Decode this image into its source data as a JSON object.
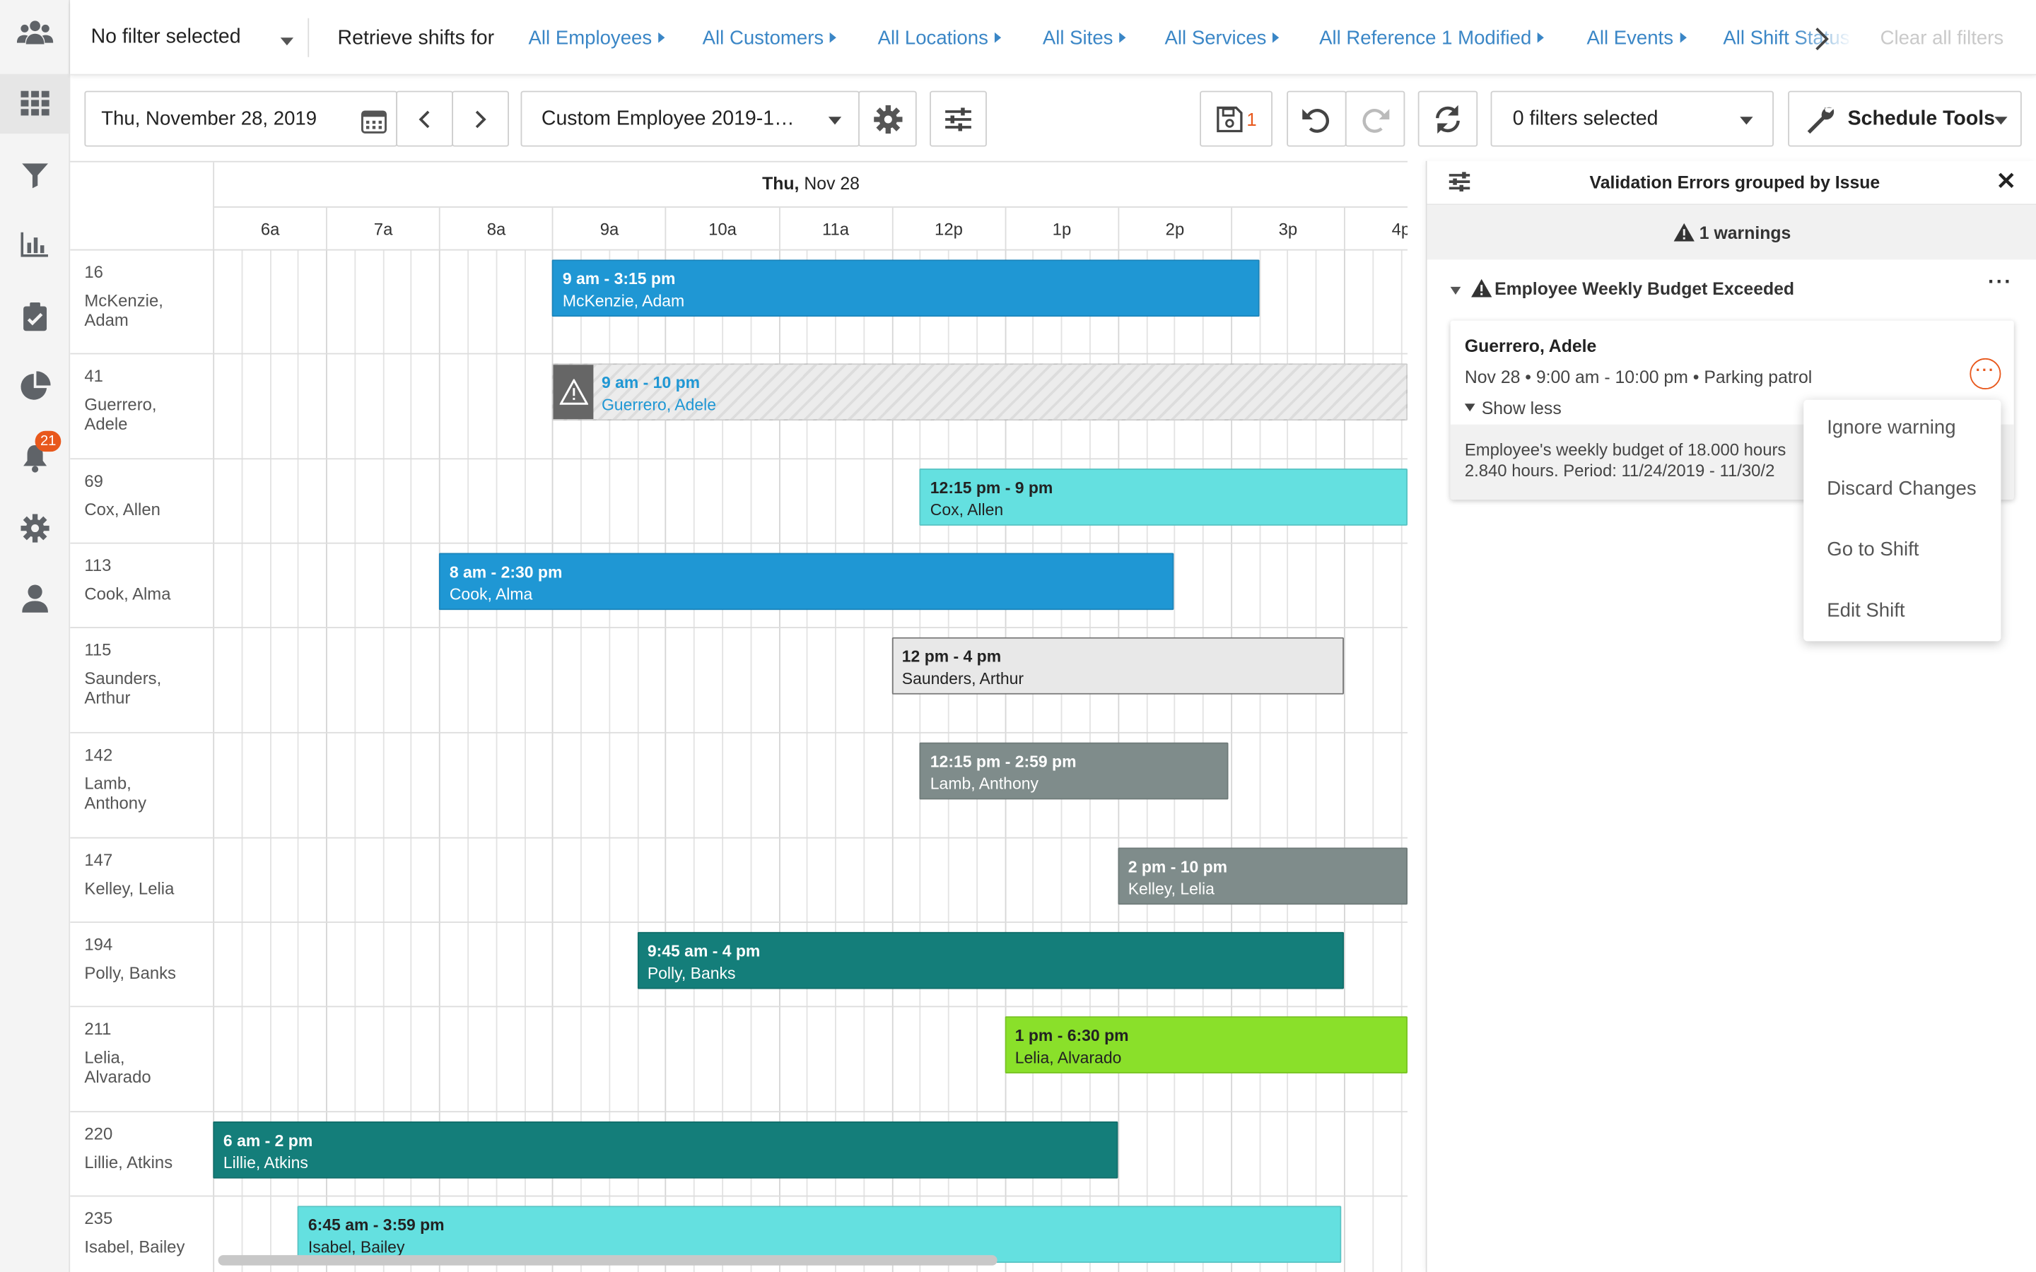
{
  "sidebar": {
    "notification_count": "21"
  },
  "filterbar": {
    "filter_select": "No filter selected",
    "retrieve_label": "Retrieve shifts for",
    "links": [
      "All Employees",
      "All Customers",
      "All Locations",
      "All Sites",
      "All Services",
      "All Reference 1 Modified",
      "All Events",
      "All Shift Status"
    ],
    "clear_all": "Clear all filters"
  },
  "toolbar": {
    "date": "Thu, November 28, 2019",
    "view": "Custom Employee 2019-1…",
    "save_count": "1",
    "filters": "0 filters selected",
    "schedule_tools": "Schedule Tools"
  },
  "schedule": {
    "day_prefix": "Thu,",
    "day": "Nov 28",
    "hours": [
      "6a",
      "7a",
      "8a",
      "9a",
      "10a",
      "11a",
      "12p",
      "1p",
      "2p",
      "3p",
      "4p"
    ],
    "rows": [
      {
        "id": "16",
        "name": "McKenzie, Adam",
        "name_lines": [
          "McKenzie,",
          "Adam"
        ]
      },
      {
        "id": "41",
        "name": "Guerrero, Adele",
        "name_lines": [
          "Guerrero,",
          "Adele"
        ]
      },
      {
        "id": "69",
        "name": "Cox, Allen",
        "name_lines": [
          "Cox, Allen"
        ]
      },
      {
        "id": "113",
        "name": "Cook, Alma",
        "name_lines": [
          "Cook, Alma"
        ]
      },
      {
        "id": "115",
        "name": "Saunders, Arthur",
        "name_lines": [
          "Saunders,",
          "Arthur"
        ]
      },
      {
        "id": "142",
        "name": "Lamb, Anthony",
        "name_lines": [
          "Lamb,",
          "Anthony"
        ]
      },
      {
        "id": "147",
        "name": "Kelley, Lelia",
        "name_lines": [
          "Kelley, Lelia"
        ]
      },
      {
        "id": "194",
        "name": "Polly, Banks",
        "name_lines": [
          "Polly, Banks"
        ]
      },
      {
        "id": "211",
        "name": "Lelia, Alvarado",
        "name_lines": [
          "Lelia,",
          "Alvarado"
        ]
      },
      {
        "id": "220",
        "name": "Lillie, Atkins",
        "name_lines": [
          "Lillie, Atkins"
        ]
      },
      {
        "id": "235",
        "name": "Isabel, Bailey",
        "name_lines": [
          "Isabel, Bailey"
        ]
      }
    ],
    "shifts": [
      {
        "row": 0,
        "time": "9 am - 3:15 pm",
        "name": "McKenzie, Adam",
        "start": 9,
        "end": 15.25,
        "color": "#1f97d4",
        "text": "#ffffff"
      },
      {
        "row": 1,
        "time": "9 am - 10 pm",
        "name": "Guerrero, Adele",
        "start": 9,
        "end": 22,
        "color": "hatched",
        "text": "#1f97d4",
        "warning": true
      },
      {
        "row": 2,
        "time": "12:15 pm - 9 pm",
        "name": "Cox, Allen",
        "start": 12.25,
        "end": 21,
        "color": "#64e0e0",
        "text": "#222222"
      },
      {
        "row": 3,
        "time": "8 am - 2:30 pm",
        "name": "Cook, Alma",
        "start": 8,
        "end": 14.5,
        "color": "#1f97d4",
        "text": "#ffffff"
      },
      {
        "row": 4,
        "time": "12 pm - 4 pm",
        "name": "Saunders, Arthur",
        "start": 12,
        "end": 16,
        "color": "#e8e8e8",
        "text": "#222222",
        "border": "#777777"
      },
      {
        "row": 5,
        "time": "12:15 pm - 2:59 pm",
        "name": "Lamb, Anthony",
        "start": 12.25,
        "end": 14.98,
        "color": "#7f8c8b",
        "text": "#ffffff"
      },
      {
        "row": 6,
        "time": "2 pm - 10 pm",
        "name": "Kelley, Lelia",
        "start": 14,
        "end": 22,
        "color": "#7f8c8b",
        "text": "#ffffff"
      },
      {
        "row": 7,
        "time": "9:45 am - 4 pm",
        "name": "Polly, Banks",
        "start": 9.75,
        "end": 16,
        "color": "#147e7a",
        "text": "#ffffff"
      },
      {
        "row": 8,
        "time": "1 pm - 6:30 pm",
        "name": "Lelia, Alvarado",
        "start": 13,
        "end": 18.5,
        "color": "#8ae02a",
        "text": "#222222"
      },
      {
        "row": 9,
        "time": "6 am - 2 pm",
        "name": "Lillie, Atkins",
        "start": 6,
        "end": 14,
        "color": "#147e7a",
        "text": "#ffffff"
      },
      {
        "row": 10,
        "time": "6:45 am - 3:59 pm",
        "name": "Isabel, Bailey",
        "start": 6.75,
        "end": 15.98,
        "color": "#64e0e0",
        "text": "#222222"
      }
    ]
  },
  "panel": {
    "title": "Validation Errors grouped by Issue",
    "warnings": "1 warnings",
    "group": "Employee Weekly Budget Exceeded",
    "card_name": "Guerrero, Adele",
    "card_detail": "Nov 28 • 9:00 am - 10:00 pm • Parking patrol",
    "show_less": "Show less",
    "message_line1": "Employee's weekly budget of 18.000 hours",
    "message_line2": "2.840 hours. Period: 11/24/2019 - 11/30/2",
    "menu": [
      "Ignore warning",
      "Discard Changes",
      "Go to Shift",
      "Edit Shift"
    ]
  }
}
